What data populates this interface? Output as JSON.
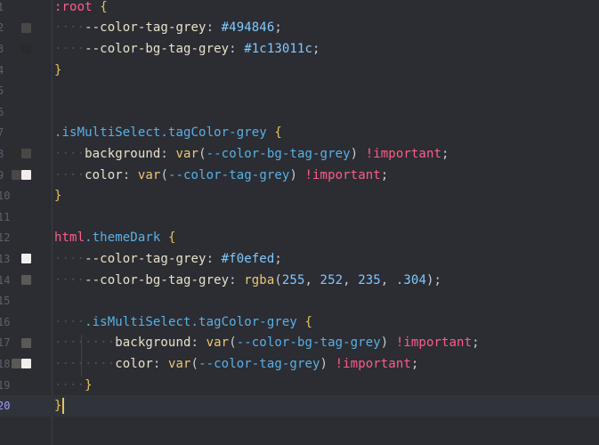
{
  "editor": {
    "lines": [
      {
        "n": "1",
        "swatches": [],
        "segments": [
          {
            "t": ":root",
            "c": "kw"
          },
          {
            "t": " ",
            "c": "punc"
          },
          {
            "t": "{",
            "c": "brace"
          }
        ]
      },
      {
        "n": "2",
        "swatches": [
          "#494846"
        ],
        "segments": [
          {
            "t": "····",
            "c": "ws"
          },
          {
            "t": "--color-tag-grey",
            "c": "prop"
          },
          {
            "t": ": ",
            "c": "punc"
          },
          {
            "t": "#494846",
            "c": "hex"
          },
          {
            "t": ";",
            "c": "punc"
          }
        ]
      },
      {
        "n": "3",
        "swatches": [
          "#1c13011c"
        ],
        "segments": [
          {
            "t": "····",
            "c": "ws"
          },
          {
            "t": "--color-bg-tag-grey",
            "c": "prop"
          },
          {
            "t": ": ",
            "c": "punc"
          },
          {
            "t": "#1c13011c",
            "c": "hex"
          },
          {
            "t": ";",
            "c": "punc"
          }
        ]
      },
      {
        "n": "4",
        "swatches": [],
        "segments": [
          {
            "t": "}",
            "c": "brace"
          }
        ]
      },
      {
        "n": "5",
        "swatches": [],
        "segments": []
      },
      {
        "n": "6",
        "swatches": [],
        "segments": []
      },
      {
        "n": "7",
        "swatches": [],
        "segments": [
          {
            "t": ".isMultiSelect",
            "c": "cls"
          },
          {
            "t": ".tagColor-grey",
            "c": "cls"
          },
          {
            "t": " ",
            "c": "punc"
          },
          {
            "t": "{",
            "c": "brace"
          }
        ]
      },
      {
        "n": "8",
        "swatches": [
          "#2e2d2b",
          "#494846"
        ],
        "segments": [
          {
            "t": "····",
            "c": "ws"
          },
          {
            "t": "background",
            "c": "prop"
          },
          {
            "t": ": ",
            "c": "punc"
          },
          {
            "t": "var",
            "c": "fn"
          },
          {
            "t": "(",
            "c": "punc"
          },
          {
            "t": "--color-bg-tag-grey",
            "c": "var"
          },
          {
            "t": ") ",
            "c": "punc"
          },
          {
            "t": "!important",
            "c": "imp"
          },
          {
            "t": ";",
            "c": "punc"
          }
        ]
      },
      {
        "n": "9",
        "swatches": [
          "#494846",
          "#f0efed"
        ],
        "segments": [
          {
            "t": "····",
            "c": "ws"
          },
          {
            "t": "color",
            "c": "prop"
          },
          {
            "t": ": ",
            "c": "punc"
          },
          {
            "t": "var",
            "c": "fn"
          },
          {
            "t": "(",
            "c": "punc"
          },
          {
            "t": "--color-tag-grey",
            "c": "var"
          },
          {
            "t": ") ",
            "c": "punc"
          },
          {
            "t": "!important",
            "c": "imp"
          },
          {
            "t": ";",
            "c": "punc"
          }
        ]
      },
      {
        "n": "10",
        "swatches": [],
        "segments": [
          {
            "t": "}",
            "c": "brace"
          }
        ]
      },
      {
        "n": "11",
        "swatches": [],
        "segments": []
      },
      {
        "n": "12",
        "swatches": [],
        "segments": [
          {
            "t": "html",
            "c": "kw"
          },
          {
            "t": ".themeDark",
            "c": "cls"
          },
          {
            "t": " ",
            "c": "punc"
          },
          {
            "t": "{",
            "c": "brace"
          }
        ]
      },
      {
        "n": "13",
        "swatches": [
          "#f0efed"
        ],
        "segments": [
          {
            "t": "····",
            "c": "ws"
          },
          {
            "t": "--color-tag-grey",
            "c": "prop"
          },
          {
            "t": ": ",
            "c": "punc"
          },
          {
            "t": "#f0efed",
            "c": "hex"
          },
          {
            "t": ";",
            "c": "punc"
          }
        ]
      },
      {
        "n": "14",
        "swatches": [
          "#5a5957"
        ],
        "segments": [
          {
            "t": "····",
            "c": "ws"
          },
          {
            "t": "--color-bg-tag-grey",
            "c": "prop"
          },
          {
            "t": ": ",
            "c": "punc"
          },
          {
            "t": "rgba",
            "c": "fn"
          },
          {
            "t": "(",
            "c": "punc"
          },
          {
            "t": "255",
            "c": "num"
          },
          {
            "t": ", ",
            "c": "punc"
          },
          {
            "t": "252",
            "c": "num"
          },
          {
            "t": ", ",
            "c": "punc"
          },
          {
            "t": "235",
            "c": "num"
          },
          {
            "t": ", ",
            "c": "punc"
          },
          {
            "t": ".304",
            "c": "num"
          },
          {
            "t": ");",
            "c": "punc"
          }
        ]
      },
      {
        "n": "15",
        "swatches": [],
        "segments": []
      },
      {
        "n": "16",
        "swatches": [],
        "segments": [
          {
            "t": "····",
            "c": "ws"
          },
          {
            "t": ".isMultiSelect",
            "c": "cls"
          },
          {
            "t": ".tagColor-grey",
            "c": "cls"
          },
          {
            "t": " ",
            "c": "punc"
          },
          {
            "t": "{",
            "c": "brace"
          }
        ]
      },
      {
        "n": "17",
        "swatches": [
          "#5a5957"
        ],
        "segments": [
          {
            "t": "········",
            "c": "ws"
          },
          {
            "t": "background",
            "c": "prop"
          },
          {
            "t": ": ",
            "c": "punc"
          },
          {
            "t": "var",
            "c": "fn"
          },
          {
            "t": "(",
            "c": "punc"
          },
          {
            "t": "--color-bg-tag-grey",
            "c": "var"
          },
          {
            "t": ") ",
            "c": "punc"
          },
          {
            "t": "!important",
            "c": "imp"
          },
          {
            "t": ";",
            "c": "punc"
          }
        ]
      },
      {
        "n": "18",
        "swatches": [
          "#5a5957",
          "#f0efed"
        ],
        "segments": [
          {
            "t": "········",
            "c": "ws"
          },
          {
            "t": "color",
            "c": "prop"
          },
          {
            "t": ": ",
            "c": "punc"
          },
          {
            "t": "var",
            "c": "fn"
          },
          {
            "t": "(",
            "c": "punc"
          },
          {
            "t": "--color-tag-grey",
            "c": "var"
          },
          {
            "t": ") ",
            "c": "punc"
          },
          {
            "t": "!important",
            "c": "imp"
          },
          {
            "t": ";",
            "c": "punc"
          }
        ]
      },
      {
        "n": "19",
        "swatches": [],
        "segments": [
          {
            "t": "····",
            "c": "ws"
          },
          {
            "t": "}",
            "c": "brace"
          }
        ]
      },
      {
        "n": "20",
        "swatches": [],
        "segments": [
          {
            "t": "}",
            "c": "brace"
          },
          {
            "t": "",
            "c": "caret"
          }
        ],
        "current": true
      }
    ]
  }
}
